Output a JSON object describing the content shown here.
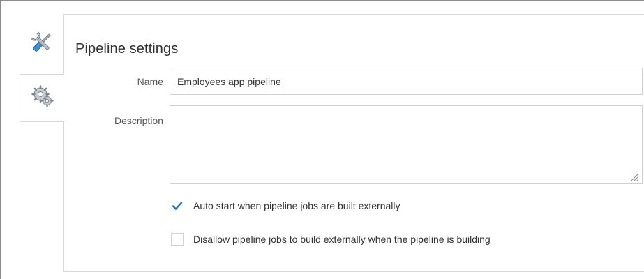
{
  "tabs": [
    {
      "icon": "tools-icon",
      "selected": false
    },
    {
      "icon": "gears-icon",
      "selected": true
    }
  ],
  "panel": {
    "title": "Pipeline settings"
  },
  "form": {
    "name_label": "Name",
    "name_value": "Employees app pipeline",
    "description_label": "Description",
    "description_value": "",
    "auto_start_label": "Auto start when pipeline jobs are built externally",
    "auto_start_checked": true,
    "disallow_label": "Disallow pipeline jobs to build externally when the pipeline is building",
    "disallow_checked": false
  },
  "colors": {
    "accent": "#1a6fc4",
    "border": "#d9d9d9",
    "text": "#333333"
  }
}
